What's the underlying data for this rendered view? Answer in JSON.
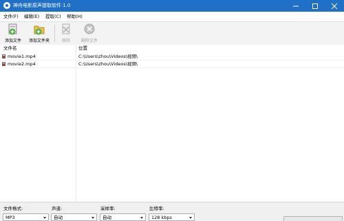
{
  "window": {
    "title": "神舟电影原声提取软件 1.0"
  },
  "menu": [
    "文件(F)",
    "编辑(E)",
    "提取(C)",
    "帮助(H)"
  ],
  "toolbar": {
    "add_file": "添加文件",
    "add_folder": "添加文件夹",
    "remove": "移除",
    "delete_file": "删除文件"
  },
  "list": {
    "columns": [
      "文件名",
      "位置"
    ],
    "rows": [
      {
        "name": "movie1.mp4",
        "location": "C:\\Users\\zhou\\Videos\\视频\\"
      },
      {
        "name": "movie2.mp4",
        "location": "C:\\Users\\zhou\\Videos\\视频\\"
      }
    ]
  },
  "settings": {
    "format": {
      "label": "文件格式:",
      "value": "MP3"
    },
    "channel": {
      "label": "声道:",
      "value": "自动"
    },
    "sample_rate": {
      "label": "采样率:",
      "value": "自动"
    },
    "bitrate": {
      "label": "比特率:",
      "value": "128 kbps"
    }
  },
  "colors": {
    "titlebar": "#1f70c6",
    "add_icon": "#57a84a",
    "disabled_icon": "#b0b0b0"
  }
}
